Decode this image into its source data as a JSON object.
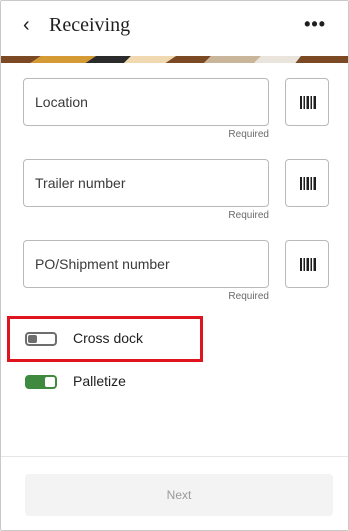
{
  "header": {
    "back_icon": "chevron-left-icon",
    "back_glyph": "‹",
    "title": "Receiving",
    "more_icon": "more-horizontal-icon",
    "more_glyph": "•••"
  },
  "banner": {
    "colors": [
      "#7b4a24",
      "#d59a33",
      "#f0d9b0",
      "#2b2b2b",
      "#c8b59a",
      "#e9e4dc"
    ]
  },
  "fields": [
    {
      "placeholder": "Location",
      "required_label": "Required",
      "scan_icon": "barcode-icon"
    },
    {
      "placeholder": "Trailer number",
      "required_label": "Required",
      "scan_icon": "barcode-icon"
    },
    {
      "placeholder": "PO/Shipment number",
      "required_label": "Required",
      "scan_icon": "barcode-icon"
    }
  ],
  "toggles": [
    {
      "label": "Cross dock",
      "checked": false
    },
    {
      "label": "Palletize",
      "checked": true
    }
  ],
  "footer": {
    "next_label": "Next",
    "next_enabled": false
  },
  "colors": {
    "highlight": "#e0141e",
    "switch_on": "#3f8a3f",
    "switch_off": "#6e6e6e"
  }
}
